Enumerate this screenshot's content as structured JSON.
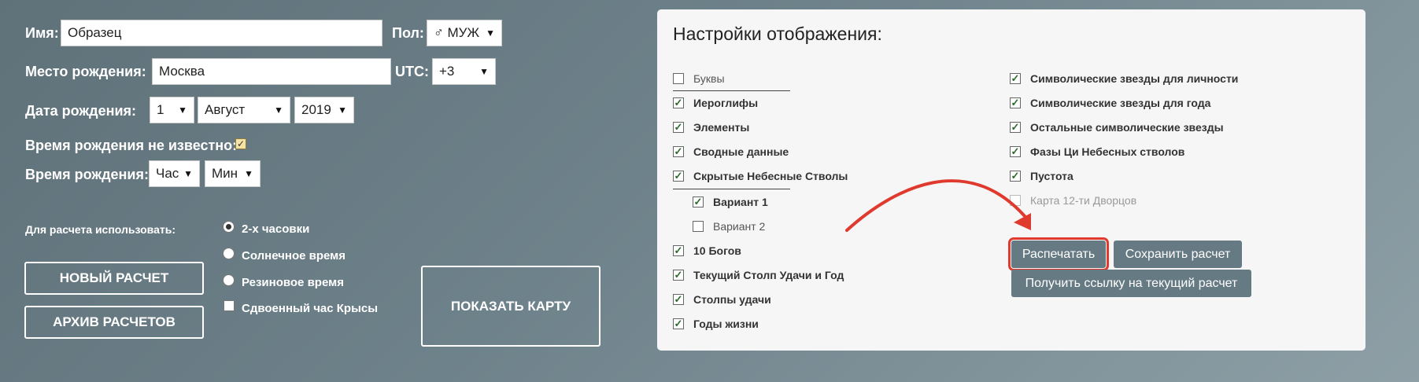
{
  "form": {
    "name_label": "Имя:",
    "name_value": "Образец",
    "sex_label": "Пол:",
    "sex_value": "♂ МУЖ",
    "birthplace_label": "Место рождения:",
    "birthplace_value": "Москва",
    "utc_label": "UTC:",
    "utc_value": "+3",
    "birthdate_label": "Дата рождения:",
    "day_value": "1",
    "month_value": "Август",
    "year_value": "2019",
    "time_unknown_label": "Время рождения не известно:",
    "time_unknown_checked": true,
    "birthtime_label": "Время рождения:",
    "hour_value": "Час",
    "minute_value": "Мин"
  },
  "calc": {
    "use_label": "Для расчета использовать:",
    "options": [
      {
        "label": "2-х часовки",
        "selected": true
      },
      {
        "label": "Солнечное время",
        "selected": false
      },
      {
        "label": "Резиновое время",
        "selected": false
      }
    ],
    "double_rat_label": "Сдвоенный час Крысы",
    "double_rat_checked": false
  },
  "buttons": {
    "new_calc": "НОВЫЙ РАСЧЕТ",
    "archive": "АРХИВ РАСЧЕТОВ",
    "show_map": "ПОКАЗАТЬ КАРТУ",
    "print": "Распечатать",
    "save": "Сохранить расчет",
    "link": "Получить ссылку на текущий расчет"
  },
  "panel": {
    "title": "Настройки отображения:",
    "left_items": [
      {
        "label": "Буквы",
        "checked": false
      },
      {
        "label": "Иероглифы",
        "checked": true
      },
      {
        "label": "Элементы",
        "checked": true
      },
      {
        "label": "Сводные данные",
        "checked": true
      },
      {
        "label": "Скрытые Небесные Стволы",
        "checked": true
      },
      {
        "label": "Вариант 1",
        "checked": true
      },
      {
        "label": "Вариант 2",
        "checked": false
      },
      {
        "label": "10 Богов",
        "checked": true
      },
      {
        "label": "Текущий Столп Удачи и Год",
        "checked": true
      },
      {
        "label": "Столпы удачи",
        "checked": true
      },
      {
        "label": "Годы жизни",
        "checked": true
      }
    ],
    "right_items": [
      {
        "label": "Символические звезды для личности",
        "checked": true
      },
      {
        "label": "Символические звезды для года",
        "checked": true
      },
      {
        "label": "Остальные символические звезды",
        "checked": true
      },
      {
        "label": "Фазы Ци Небесных стволов",
        "checked": true
      },
      {
        "label": "Пустота",
        "checked": true
      },
      {
        "label": "Карта 12-ти Дворцов",
        "checked": false
      }
    ]
  },
  "colors": {
    "highlight": "#e03a2f",
    "button_bg": "#667a83"
  }
}
